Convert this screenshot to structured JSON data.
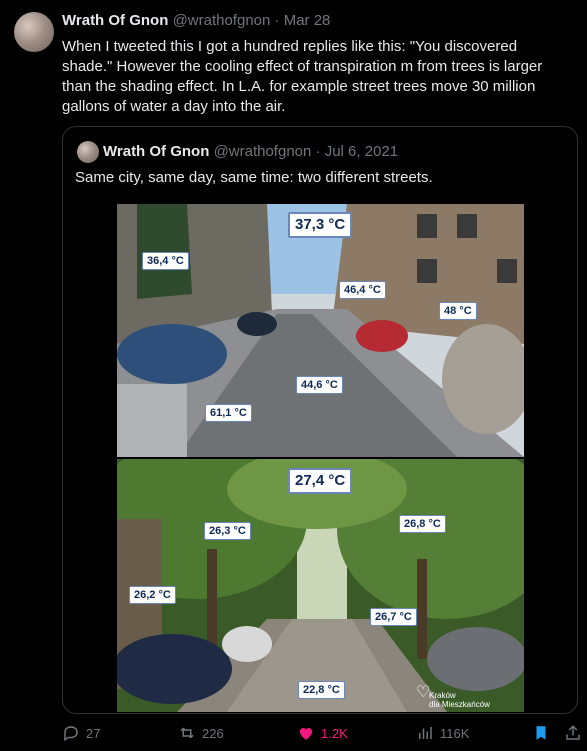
{
  "tweet": {
    "author_name": "Wrath Of Gnon",
    "handle": "@wrathofgnon",
    "separator": "·",
    "date": "Mar 28",
    "text": "When I tweeted this I got a hundred replies like this: \"You discovered shade.\" However the cooling effect of transpiration m from trees is larger than the shading effect. In L.A. for example street trees move 30 million gallons of water a day into the air."
  },
  "quote": {
    "author_name": "Wrath Of Gnon",
    "handle": "@wrathofgnon",
    "separator": "·",
    "date": "Jul 6, 2021",
    "text": "Same city, same day, same time: two different streets."
  },
  "photo_top": {
    "air_temp": "37,3 °C",
    "labels": [
      "36,4 °C",
      "46,4 °C",
      "48 °C",
      "44,6 °C",
      "61,1 °C"
    ]
  },
  "photo_bottom": {
    "air_temp": "27,4 °C",
    "labels": [
      "26,3 °C",
      "26,8 °C",
      "26,2 °C",
      "26,7 °C",
      "22,8 °C"
    ],
    "credit_line1": "Kraków",
    "credit_line2": "dla Mieszkańców"
  },
  "actions": {
    "replies": "27",
    "reposts": "226",
    "likes": "1.2K",
    "views": "116K"
  },
  "colors": {
    "like": "#f91880",
    "bookmark": "#1d9bf0"
  }
}
